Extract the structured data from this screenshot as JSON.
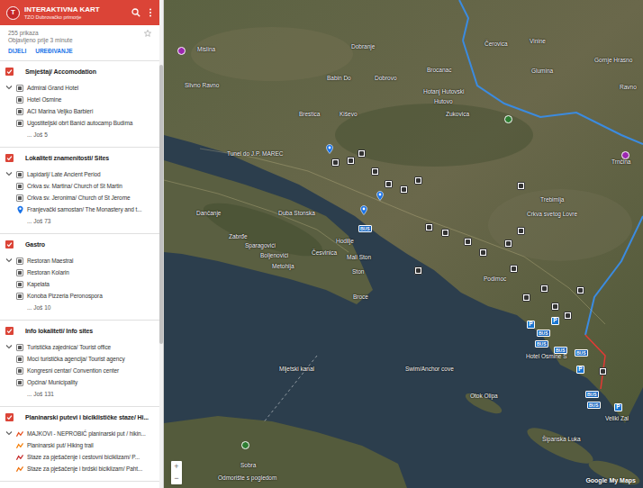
{
  "header": {
    "avatar": "T",
    "title": "INTERAKTIVNA KART",
    "subtitle": "TZO Dubrovačko primorje"
  },
  "info": {
    "views": "255 prikaza",
    "published": "Objavljeno prije 3 minute",
    "starred": false
  },
  "actions": [
    {
      "label": "DIJELI"
    },
    {
      "label": "UREĐIVANJE"
    }
  ],
  "layers": [
    {
      "title": "Smještaj/ Accomodation",
      "checked": true,
      "expanded": true,
      "more": "... Još 5",
      "items": [
        {
          "label": "Admiral Grand Hotel",
          "kind": "marker"
        },
        {
          "label": "Hotel Osmine",
          "kind": "marker"
        },
        {
          "label": "ACI Marina Veljko Barbieri",
          "kind": "marker"
        },
        {
          "label": "Ugostiteljski obrt Banići autocamp Budima",
          "kind": "marker"
        }
      ]
    },
    {
      "title": "Lokaliteti znamenitosti/ Sites",
      "checked": true,
      "expanded": true,
      "more": "... Još 73",
      "items": [
        {
          "label": "Lapidarij/ Late Ancient Period",
          "kind": "marker"
        },
        {
          "label": "Crkva sv. Martina/ Church of St Martin",
          "kind": "marker"
        },
        {
          "label": "Crkva sv. Jeronima/ Church of St Jerome",
          "kind": "marker"
        },
        {
          "label": "Franjevački samostan/ The Monastery and t...",
          "kind": "pin"
        }
      ]
    },
    {
      "title": "Gastro",
      "checked": true,
      "expanded": true,
      "more": "... Još 10",
      "items": [
        {
          "label": "Restoran Maestral",
          "kind": "marker"
        },
        {
          "label": "Restoran Kolarin",
          "kind": "marker"
        },
        {
          "label": "Kapelata",
          "kind": "marker"
        },
        {
          "label": "Konoba Pizzeria Peronospora",
          "kind": "marker"
        }
      ]
    },
    {
      "title": "Info lokaliteti/ Info sites",
      "checked": true,
      "expanded": true,
      "more": "... Još 131",
      "items": [
        {
          "label": "Turistička zajednica/ Tourist office",
          "kind": "marker"
        },
        {
          "label": "Moci turistička agencija/ Tourist agency",
          "kind": "marker"
        },
        {
          "label": "Kongresni centar/ Convention center",
          "kind": "marker"
        },
        {
          "label": "Općina/ Municipality",
          "kind": "marker"
        }
      ]
    },
    {
      "title": "Planinarski putevi i biciklističke staze/ Hi...",
      "checked": true,
      "expanded": true,
      "items": [
        {
          "label": "MAJKOVI - NEPROBIĆ planinarski put / hikin...",
          "kind": "line",
          "color": "#e64a19"
        },
        {
          "label": "Planinarski put/ Hiking trail",
          "kind": "line",
          "color": "#f57c00"
        },
        {
          "label": "Staze za pješačenje i cestovni biciklizam/ P...",
          "kind": "line",
          "color": "#c62828"
        },
        {
          "label": "Staze za pješačenje i brdski biciklizam/ Paht...",
          "kind": "line",
          "color": "#ef6c00"
        }
      ]
    }
  ],
  "map": {
    "labels": [
      "Mislina",
      "Dobranje",
      "Čerovica",
      "Vinine",
      "Gornje Hrasno",
      "Slivno Ravno",
      "Babin Do",
      "Dobrovo",
      "Brocanac",
      "Hotanj Hutovski",
      "Glumina",
      "Ravno",
      "Hutovo",
      "Brestica",
      "Kiševo",
      "Zukovica",
      "Tunel do J.P. MAREC",
      "Trnčina",
      "Trebimlja",
      "Crkva svetog Lovre",
      "Dančanje",
      "Duba Stonska",
      "Zabrđe",
      "Hodilje",
      "Sparagovići",
      "Česvinica",
      "Boljenovići",
      "Mali Ston",
      "Metohija",
      "Ston",
      "Broce",
      "Podimoc",
      "Hotel Osmine S",
      "Mljetski kanal",
      "Swim/Anchor cove",
      "Otok Olipa",
      "Veliki Zal",
      "Šipanska Luka",
      "Sobra",
      "Odmorište s pogledom"
    ],
    "pins": [
      {
        "kind": "marker"
      },
      {
        "kind": "marker"
      },
      {
        "kind": "marker"
      },
      {
        "kind": "icon"
      },
      {
        "kind": "icon"
      },
      {
        "kind": "icon"
      },
      {
        "kind": "icon"
      },
      {
        "kind": "icon"
      },
      {
        "kind": "icon"
      },
      {
        "kind": "icon"
      },
      {
        "kind": "icon"
      },
      {
        "kind": "icon"
      },
      {
        "kind": "icon"
      },
      {
        "kind": "icon"
      },
      {
        "kind": "icon"
      },
      {
        "kind": "icon"
      },
      {
        "kind": "icon"
      },
      {
        "kind": "icon"
      },
      {
        "kind": "icon"
      },
      {
        "kind": "icon"
      },
      {
        "kind": "icon"
      },
      {
        "kind": "icon"
      },
      {
        "kind": "icon"
      },
      {
        "kind": "icon"
      },
      {
        "kind": "icon"
      },
      {
        "kind": "bus",
        "text": "BUS"
      },
      {
        "kind": "bus",
        "text": "BUS"
      },
      {
        "kind": "bus",
        "text": "BUS"
      },
      {
        "kind": "bus",
        "text": "BUS"
      },
      {
        "kind": "bus",
        "text": "BUS"
      },
      {
        "kind": "bus",
        "text": "BUS"
      },
      {
        "kind": "bus",
        "text": "BUS"
      },
      {
        "kind": "parking",
        "text": "P"
      },
      {
        "kind": "parking",
        "text": "P"
      },
      {
        "kind": "parking",
        "text": "P"
      },
      {
        "kind": "parking",
        "text": "P"
      },
      {
        "kind": "green"
      },
      {
        "kind": "green"
      },
      {
        "kind": "poi"
      },
      {
        "kind": "poi"
      }
    ],
    "zoom": [
      "+",
      "−"
    ],
    "logo": "Google My Maps"
  }
}
